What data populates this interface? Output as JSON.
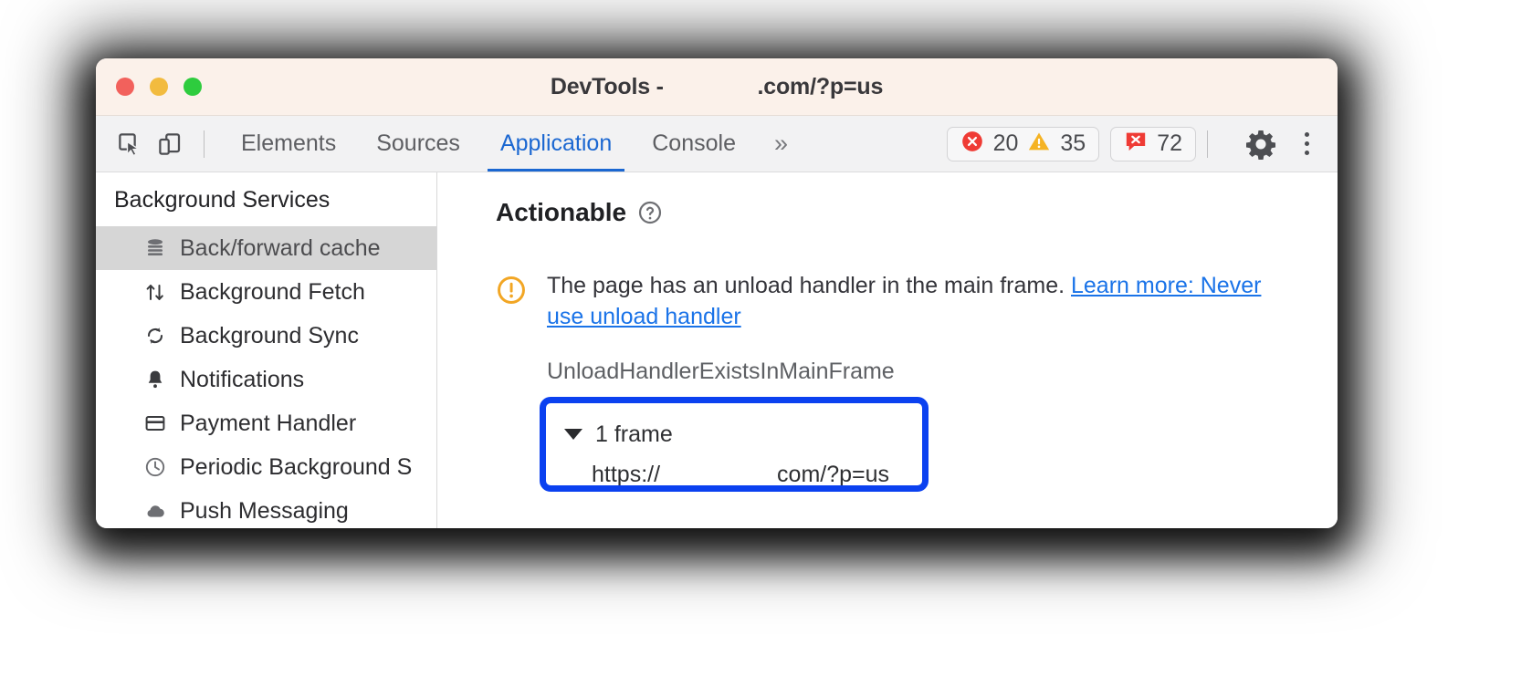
{
  "window": {
    "title_prefix": "DevTools - ",
    "title_suffix": ".com/?p=us",
    "traffic_lights": [
      "close-red",
      "minimize-yellow",
      "zoom-green"
    ]
  },
  "toolbar": {
    "inspect_icon": "inspect-element-icon",
    "device_icon": "device-toolbar-icon",
    "tabs": [
      {
        "label": "Elements",
        "active": false
      },
      {
        "label": "Sources",
        "active": false
      },
      {
        "label": "Application",
        "active": true
      },
      {
        "label": "Console",
        "active": false
      }
    ],
    "more_tabs": "»",
    "counters": {
      "errors": "20",
      "warnings": "35",
      "issues": "72",
      "error_icon": "error-circle-icon",
      "warning_icon": "warning-triangle-icon",
      "issues_icon": "issues-bubble-icon"
    },
    "settings_icon": "gear-icon",
    "menu_icon": "kebab-menu-icon"
  },
  "sidebar": {
    "section_title": "Background Services",
    "items": [
      {
        "label": "Back/forward cache",
        "icon": "database-icon",
        "selected": true
      },
      {
        "label": "Background Fetch",
        "icon": "arrows-updown-icon",
        "selected": false
      },
      {
        "label": "Background Sync",
        "icon": "sync-icon",
        "selected": false
      },
      {
        "label": "Notifications",
        "icon": "bell-icon",
        "selected": false
      },
      {
        "label": "Payment Handler",
        "icon": "credit-card-icon",
        "selected": false
      },
      {
        "label": "Periodic Background S",
        "icon": "clock-icon",
        "selected": false
      },
      {
        "label": "Push Messaging",
        "icon": "cloud-icon",
        "selected": false
      }
    ]
  },
  "main": {
    "panel_title": "Actionable",
    "help_icon": "question-circle-icon",
    "issue_icon": "warning-circle-icon",
    "issue_text": "The page has an unload handler in the main frame. ",
    "issue_link": "Learn more: Never use unload handler",
    "reason_code": "UnloadHandlerExistsInMainFrame",
    "frames": {
      "toggle_icon": "triangle-down-icon",
      "summary": "1 frame",
      "url_prefix": "https://",
      "url_suffix": "com/?p=us",
      "highlight_color": "#0b41f0"
    }
  }
}
